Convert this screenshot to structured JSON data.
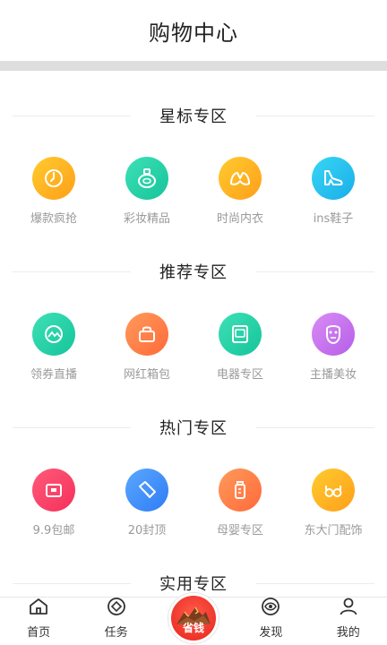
{
  "header": {
    "title": "购物中心"
  },
  "sections": [
    {
      "title": "星标专区",
      "items": [
        {
          "label": "爆款疯抢",
          "icon": "clock-icon",
          "color_from": "#ffcb2e",
          "color_to": "#ff9f1a"
        },
        {
          "label": "彩妆精品",
          "icon": "perfume-icon",
          "color_from": "#3ee0b6",
          "color_to": "#16c49a"
        },
        {
          "label": "时尚内衣",
          "icon": "bra-icon",
          "color_from": "#ffcb2e",
          "color_to": "#ff9f1a"
        },
        {
          "label": "ins鞋子",
          "icon": "high-heel-icon",
          "color_from": "#38d6f5",
          "color_to": "#1aaee8"
        }
      ]
    },
    {
      "title": "推荐专区",
      "items": [
        {
          "label": "领券直播",
          "icon": "live-icon",
          "color_from": "#3ee0b6",
          "color_to": "#16c49a"
        },
        {
          "label": "网红箱包",
          "icon": "bag-icon",
          "color_from": "#ff9a5a",
          "color_to": "#ff6a3a"
        },
        {
          "label": "电器专区",
          "icon": "appliance-icon",
          "color_from": "#3ee0b6",
          "color_to": "#16c49a"
        },
        {
          "label": "主播美妆",
          "icon": "face-mask-icon",
          "color_from": "#d98cf5",
          "color_to": "#b65ee8"
        }
      ]
    },
    {
      "title": "热门专区",
      "items": [
        {
          "label": "9.9包邮",
          "icon": "parcel-icon",
          "color_from": "#ff5a7a",
          "color_to": "#f5305a"
        },
        {
          "label": "20封顶",
          "icon": "tag-icon",
          "color_from": "#5aa8ff",
          "color_to": "#2f7cf5"
        },
        {
          "label": "母婴专区",
          "icon": "baby-bottle-icon",
          "color_from": "#ff9a5a",
          "color_to": "#ff6a3a"
        },
        {
          "label": "东大门配饰",
          "icon": "glasses-icon",
          "color_from": "#ffcb2e",
          "color_to": "#ff9f1a"
        }
      ]
    },
    {
      "title": "实用专区",
      "items": []
    }
  ],
  "tabbar": {
    "items": [
      {
        "label": "首页",
        "icon": "home-icon"
      },
      {
        "label": "任务",
        "icon": "task-icon"
      },
      {
        "label": "省钱",
        "icon": "save-money-icon"
      },
      {
        "label": "发现",
        "icon": "discover-icon"
      },
      {
        "label": "我的",
        "icon": "profile-icon"
      }
    ]
  }
}
